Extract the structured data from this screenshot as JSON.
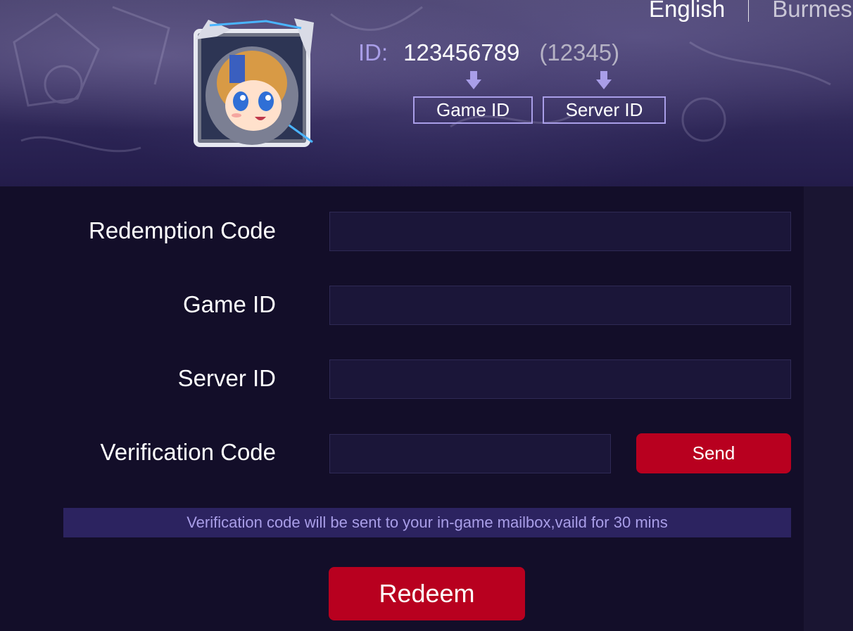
{
  "header": {
    "languages": {
      "current": "English",
      "other": "Burmese"
    },
    "id_info": {
      "label": "ID:",
      "game_id_value": "123456789",
      "server_id_value": "(12345)",
      "game_id_tag": "Game ID",
      "server_id_tag": "Server ID"
    },
    "avatar_icon": "hero-avatar-icon",
    "arrow_icon": "down-arrow-icon"
  },
  "form": {
    "redemption_code_label": "Redemption Code",
    "redemption_code_value": "",
    "game_id_label": "Game ID",
    "game_id_value": "",
    "server_id_label": "Server ID",
    "server_id_value": "",
    "verification_code_label": "Verification Code",
    "verification_code_value": "",
    "send_label": "Send",
    "notice": "Verification code will be sent to your in-game mailbox,vaild for 30 mins",
    "redeem_label": "Redeem"
  },
  "colors": {
    "accent": "#a99ee8",
    "button_red": "#b8001f",
    "background": "#130e29",
    "input_bg": "#1b1639",
    "notice_bg": "#2c2360"
  }
}
